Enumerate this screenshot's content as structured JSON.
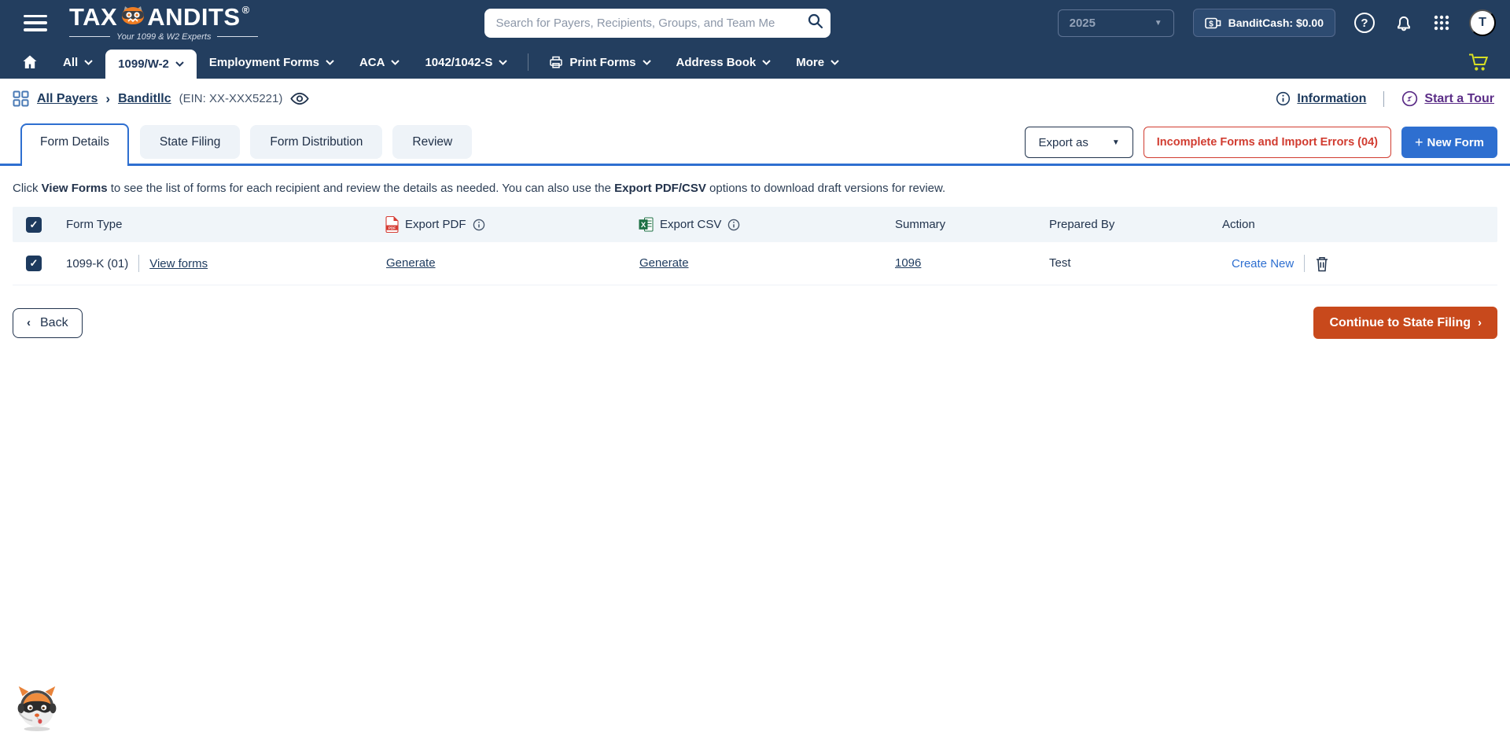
{
  "header": {
    "logo_tax": "TAX",
    "logo_andits": "ANDITS",
    "logo_reg": "®",
    "logo_tagline": "Your 1099 & W2 Experts",
    "search_placeholder": "Search for Payers, Recipients, Groups, and Team Me",
    "year": "2025",
    "bandit_cash": "BanditCash: $0.00",
    "avatar_initial": "T"
  },
  "nav": {
    "items": [
      {
        "label": "All"
      },
      {
        "label": "1099/W-2"
      },
      {
        "label": "Employment Forms"
      },
      {
        "label": "ACA"
      },
      {
        "label": "1042/1042-S"
      },
      {
        "label": "Print Forms"
      },
      {
        "label": "Address Book"
      },
      {
        "label": "More"
      }
    ]
  },
  "breadcrumb": {
    "all_payers": "All Payers",
    "separator": "›",
    "payer_name": "Banditllc",
    "ein": "(EIN: XX-XXX5221)",
    "information_link": "Information",
    "start_tour_link": "Start a Tour"
  },
  "tabs": [
    {
      "label": "Form Details"
    },
    {
      "label": "State Filing"
    },
    {
      "label": "Form Distribution"
    },
    {
      "label": "Review"
    }
  ],
  "toolbar": {
    "export_as": "Export as",
    "incomplete_forms": "Incomplete Forms and Import Errors (04)",
    "new_form": "New Form"
  },
  "instruction": {
    "part1": "Click ",
    "bold1": "View Forms",
    "part2": " to see the list of forms for each recipient and review the details as needed. You can also use the ",
    "bold2": "Export PDF/CSV",
    "part3": " options to download draft versions for review."
  },
  "table": {
    "headers": {
      "form_type": "Form Type",
      "export_pdf": "Export PDF",
      "export_csv": "Export CSV",
      "summary": "Summary",
      "prepared_by": "Prepared By",
      "action": "Action"
    },
    "row": {
      "form_type": "1099-K (01)",
      "view_forms": "View forms",
      "export_pdf_link": "Generate",
      "export_csv_link": "Generate",
      "summary_link": "1096",
      "prepared_by": "Test",
      "create_new": "Create New"
    }
  },
  "footer": {
    "back": "Back",
    "continue": "Continue to State Filing"
  },
  "icons": {
    "checkmark": "✓",
    "caret_down": "▼",
    "chevron_left": "‹",
    "chevron_right": "›",
    "plus": "+",
    "question_mark": "?",
    "dollar": "$",
    "pdf_label": "PDF",
    "excel_label": "X"
  },
  "colors": {
    "header_navy": "#233e5f",
    "accent_blue": "#2e6fd0",
    "danger_red": "#d13c30",
    "continue_orange": "#c8491c",
    "cart_yellow": "#d7df23",
    "tour_purple": "#5b2d87"
  }
}
